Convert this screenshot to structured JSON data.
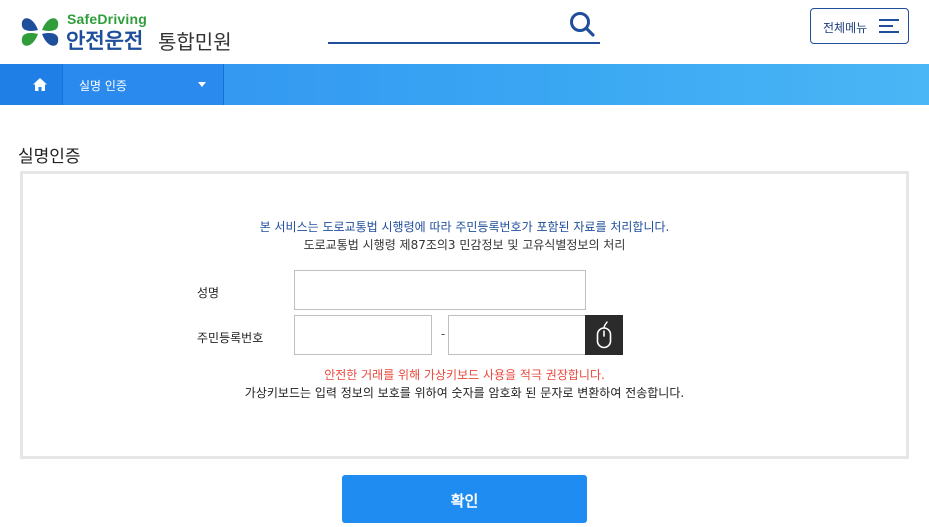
{
  "header": {
    "logo_en": "SafeDriving",
    "logo_ko": "안전운전",
    "logo_ko2": "통합민원",
    "search_placeholder": "",
    "search_icon": "search-icon",
    "menu_label": "전체메뉴",
    "menu_icon": "hamburger-icon"
  },
  "nav": {
    "home_icon": "home-icon",
    "selected": "실명 인증",
    "caret_icon": "caret-down-icon"
  },
  "page": {
    "title": "실명인증"
  },
  "form": {
    "notice_line1": "본 서비스는 도로교통법 시행령에 따라 주민등록번호가 포함된 자료를 처리합니다.",
    "notice_line2": "도로교통법 시행령 제87조의3 민감정보 및 고유식별정보의 처리",
    "name_label": "성명",
    "name_value": "",
    "rrn_label": "주민등록번호",
    "rrn_front_value": "",
    "rrn_separator": "-",
    "rrn_back_value": "",
    "vkbd_icon": "mouse-icon",
    "warning": "안전한 거래를 위해 가상키보드 사용을 적극 권장합니다.",
    "info": "가상키보드는 입력 정보의 보호를 위하여 숫자를 암호화 된 문자로 변환하여 전송합니다."
  },
  "actions": {
    "confirm_label": "확인"
  },
  "colors": {
    "brand_blue": "#1f4e9c",
    "brand_green": "#2f9e3a",
    "nav_blue": "#2f8ff0",
    "button_blue": "#1e8cf0",
    "warning_red": "#e8493c"
  }
}
